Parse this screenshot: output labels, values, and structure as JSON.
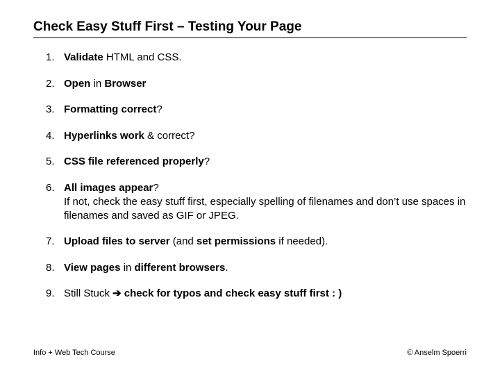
{
  "title": "Check Easy Stuff First – Testing Your Page",
  "items": [
    {
      "html": "<span class='b'>Validate</span> HTML and CSS."
    },
    {
      "html": "<span class='b'>Open</span> in <span class='b'>Browser</span>"
    },
    {
      "html": "<span class='b'>Formatting correct</span>?"
    },
    {
      "html": "<span class='b'>Hyperlinks work</span> &amp; correct?"
    },
    {
      "html": "<span class='b'>CSS file referenced properly</span>?"
    },
    {
      "html": "<span class='b'>All images appear</span>?",
      "sub": "If not, check the easy stuff first, especially spelling of filenames and don’t use spaces in filenames and saved as GIF or JPEG."
    },
    {
      "html": "<span class='b'>Upload files to server</span> (and <span class='b'>set permissions</span> if needed)."
    },
    {
      "html": "<span class='b'>View pages</span> in <span class='b'>different browsers</span>."
    },
    {
      "html": "Still Stuck <span class='b'>➔ check for typos and check easy stuff first : )</span>"
    }
  ],
  "footer": {
    "left": "Info + Web Tech Course",
    "right": "© Anselm Spoerri"
  }
}
